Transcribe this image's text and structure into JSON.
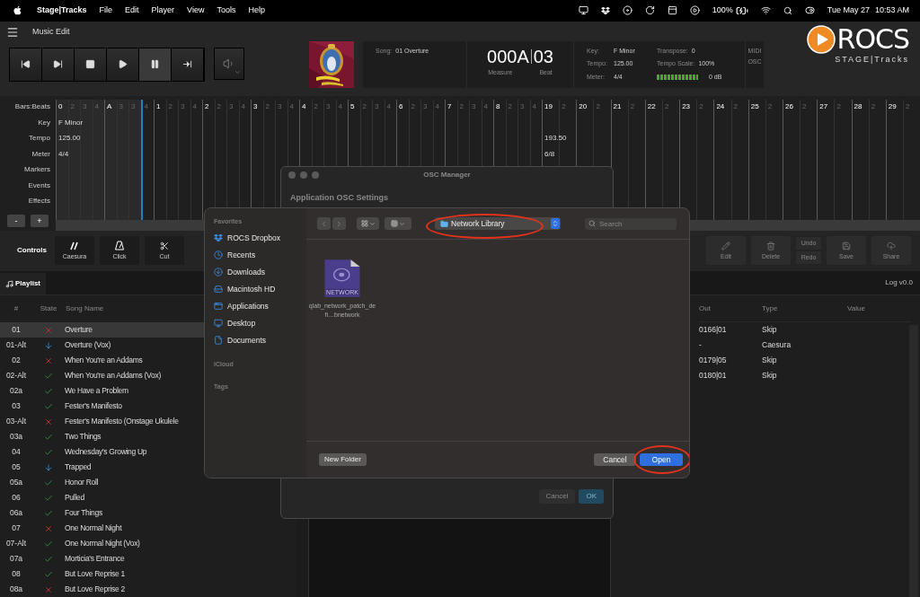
{
  "menu_bar": {
    "app": "Stage|Tracks",
    "menus": [
      "File",
      "Edit",
      "Player",
      "View",
      "Tools",
      "Help"
    ],
    "battery": "100%",
    "date": "Tue May 27",
    "time": "10:53 AM"
  },
  "header": {
    "title": "Music Edit",
    "transport": [
      {
        "kind": "prev",
        "selected": false
      },
      {
        "kind": "next",
        "selected": false
      },
      {
        "kind": "stop",
        "selected": false
      },
      {
        "kind": "play",
        "selected": false
      },
      {
        "kind": "pause",
        "selected": true
      },
      {
        "kind": "end",
        "selected": false
      }
    ],
    "song_label": "Song:",
    "song": "01 Overture",
    "measure": "000A",
    "beat": "03",
    "measure_label": "Measure",
    "beat_label": "Beat",
    "info_left": [
      {
        "label": "Key:",
        "value": "F Minor"
      },
      {
        "label": "Tempo:",
        "value": "125.00"
      },
      {
        "label": "Meter:",
        "value": "4/4"
      }
    ],
    "info_right": [
      {
        "label": "Transpose:",
        "value": "0"
      },
      {
        "label": "Tempo Scale:",
        "value": "100%"
      }
    ],
    "meter": {
      "level": 1,
      "reading": "0 dB"
    },
    "indicators": [
      "MIDI",
      "OSC"
    ],
    "logo": {
      "name": "ROCS",
      "tagline": "STAGE|Tracks"
    }
  },
  "timeline": {
    "tracks": [
      "Bars:Beats",
      "Key",
      "Tempo",
      "Meter",
      "Markers",
      "Events",
      "Effects"
    ],
    "zoom_buttons": [
      "-",
      "+"
    ],
    "sections": [
      {
        "key": "F Minor",
        "tempo": "125.00",
        "meter": "4/4",
        "cells": [
          {
            "beat": "0",
            "kind": "bar",
            "playhead": false
          },
          {
            "beat": "2",
            "kind": "beat",
            "playhead": false
          },
          {
            "beat": "3",
            "kind": "beat",
            "playhead": false
          },
          {
            "beat": "4",
            "kind": "beat",
            "playhead": false
          },
          {
            "beat": "A",
            "kind": "bar",
            "playhead": false
          },
          {
            "beat": "3",
            "kind": "beat",
            "playhead": false
          },
          {
            "beat": "3",
            "kind": "beat",
            "playhead": false
          },
          {
            "beat": "4",
            "kind": "beat",
            "playhead": true
          },
          {
            "beat": "1",
            "kind": "bar",
            "playhead": false
          },
          {
            "beat": "2",
            "kind": "beat",
            "playhead": false
          },
          {
            "beat": "3",
            "kind": "beat",
            "playhead": false
          },
          {
            "beat": "4",
            "kind": "beat",
            "playhead": false
          },
          {
            "beat": "2",
            "kind": "bar",
            "playhead": false
          },
          {
            "beat": "2",
            "kind": "beat",
            "playhead": false
          },
          {
            "beat": "3",
            "kind": "beat",
            "playhead": false
          },
          {
            "beat": "4",
            "kind": "beat",
            "playhead": false
          },
          {
            "beat": "3",
            "kind": "bar",
            "playhead": false
          },
          {
            "beat": "2",
            "kind": "beat",
            "playhead": false
          },
          {
            "beat": "3",
            "kind": "beat",
            "playhead": false
          },
          {
            "beat": "4",
            "kind": "beat",
            "playhead": false
          },
          {
            "beat": "4",
            "kind": "bar",
            "playhead": false
          },
          {
            "beat": "2",
            "kind": "beat",
            "playhead": false
          },
          {
            "beat": "3",
            "kind": "beat",
            "playhead": false
          },
          {
            "beat": "4",
            "kind": "beat",
            "playhead": false
          },
          {
            "beat": "5",
            "kind": "bar",
            "playhead": false
          },
          {
            "beat": "2",
            "kind": "beat",
            "playhead": false
          },
          {
            "beat": "3",
            "kind": "beat",
            "playhead": false
          },
          {
            "beat": "4",
            "kind": "beat",
            "playhead": false
          },
          {
            "beat": "6",
            "kind": "bar",
            "playhead": false
          },
          {
            "beat": "2",
            "kind": "beat",
            "playhead": false
          },
          {
            "beat": "3",
            "kind": "beat",
            "playhead": false
          },
          {
            "beat": "4",
            "kind": "beat",
            "playhead": false
          },
          {
            "beat": "7",
            "kind": "bar",
            "playhead": false
          },
          {
            "beat": "2",
            "kind": "beat",
            "playhead": false
          },
          {
            "beat": "3",
            "kind": "beat",
            "playhead": false
          },
          {
            "beat": "4",
            "kind": "beat",
            "playhead": false
          },
          {
            "beat": "8",
            "kind": "bar",
            "playhead": false
          },
          {
            "beat": "2",
            "kind": "beat",
            "playhead": false
          },
          {
            "beat": "3",
            "kind": "beat",
            "playhead": false
          },
          {
            "beat": "4",
            "kind": "beat",
            "playhead": false
          }
        ]
      },
      {
        "tempo": "193.50",
        "meter": "6/8",
        "cells": [
          {
            "beat": "19",
            "kind": "bar",
            "playhead": false
          },
          {
            "beat": "2",
            "kind": "beat",
            "playhead": false
          },
          {
            "beat": "20",
            "kind": "bar",
            "playhead": false
          },
          {
            "beat": "2",
            "kind": "beat",
            "playhead": false
          },
          {
            "beat": "21",
            "kind": "bar",
            "playhead": false
          },
          {
            "beat": "2",
            "kind": "beat",
            "playhead": false
          },
          {
            "beat": "22",
            "kind": "bar",
            "playhead": false
          },
          {
            "beat": "2",
            "kind": "beat",
            "playhead": false
          },
          {
            "beat": "23",
            "kind": "bar",
            "playhead": false
          },
          {
            "beat": "2",
            "kind": "beat",
            "playhead": false
          },
          {
            "beat": "24",
            "kind": "bar",
            "playhead": false
          },
          {
            "beat": "2",
            "kind": "beat",
            "playhead": false
          },
          {
            "beat": "25",
            "kind": "bar",
            "playhead": false
          },
          {
            "beat": "2",
            "kind": "beat",
            "playhead": false
          },
          {
            "beat": "26",
            "kind": "bar",
            "playhead": false
          },
          {
            "beat": "2",
            "kind": "beat",
            "playhead": false
          },
          {
            "beat": "27",
            "kind": "bar",
            "playhead": false
          },
          {
            "beat": "2",
            "kind": "beat",
            "playhead": false
          },
          {
            "beat": "28",
            "kind": "bar",
            "playhead": false
          },
          {
            "beat": "2",
            "kind": "beat",
            "playhead": false
          },
          {
            "beat": "29",
            "kind": "bar",
            "playhead": false
          },
          {
            "beat": "2",
            "kind": "beat",
            "playhead": false
          }
        ]
      }
    ]
  },
  "controls": {
    "label": "Controls",
    "left": [
      {
        "label": "Caesura",
        "kind": "caesura",
        "disabled": false
      },
      {
        "label": "Click",
        "kind": "click",
        "disabled": false
      },
      {
        "label": "Cut",
        "kind": "cut",
        "disabled": false
      }
    ],
    "edit": [
      {
        "label": "Edit",
        "kind": "edit",
        "disabled": true
      },
      {
        "label": "Delete",
        "kind": "delete",
        "disabled": true
      }
    ],
    "history": [
      "Undo",
      "Redo"
    ],
    "file": [
      {
        "label": "Save",
        "kind": "save",
        "disabled": true
      },
      {
        "label": "Share",
        "kind": "share",
        "disabled": true
      }
    ]
  },
  "playlist": {
    "tab": "Playlist",
    "columns": [
      "#",
      "State",
      "Song Name"
    ],
    "rows": [
      {
        "number": "01",
        "kind": "cross",
        "name": "Overture",
        "selected": true
      },
      {
        "number": "01-Alt",
        "kind": "down",
        "name": "Overture (Vox)",
        "selected": false
      },
      {
        "number": "02",
        "kind": "cross",
        "name": "When You're an Addams",
        "selected": false
      },
      {
        "number": "02-Alt",
        "kind": "check",
        "name": "When You're an Addams (Vox)",
        "selected": false
      },
      {
        "number": "02a",
        "kind": "check",
        "name": "We Have a Problem",
        "selected": false
      },
      {
        "number": "03",
        "kind": "check",
        "name": "Fester's Manifesto",
        "selected": false
      },
      {
        "number": "03-Alt",
        "kind": "cross",
        "name": "Fester's Manifesto (Onstage Ukulele",
        "selected": false
      },
      {
        "number": "03a",
        "kind": "check",
        "name": "Two Things",
        "selected": false
      },
      {
        "number": "04",
        "kind": "check",
        "name": "Wednesday's Growing Up",
        "selected": false
      },
      {
        "number": "05",
        "kind": "down",
        "name": "Trapped",
        "selected": false
      },
      {
        "number": "05a",
        "kind": "check",
        "name": "Honor Roll",
        "selected": false
      },
      {
        "number": "06",
        "kind": "check",
        "name": "Pulled",
        "selected": false
      },
      {
        "number": "06a",
        "kind": "check",
        "name": "Four Things",
        "selected": false
      },
      {
        "number": "07",
        "kind": "cross",
        "name": "One Normal Night",
        "selected": false
      },
      {
        "number": "07-Alt",
        "kind": "check",
        "name": "One Normal Night (Vox)",
        "selected": false
      },
      {
        "number": "07a",
        "kind": "check",
        "name": "Morticia's Entrance",
        "selected": false
      },
      {
        "number": "08",
        "kind": "check",
        "name": "But Love Reprise 1",
        "selected": false
      },
      {
        "number": "08a",
        "kind": "cross",
        "name": "But Love Reprise 2",
        "selected": false
      }
    ]
  },
  "log": {
    "title": "Log v0.0",
    "columns": [
      "Out",
      "Type",
      "Value"
    ],
    "rows": [
      {
        "out": "0166|01",
        "type": "Skip"
      },
      {
        "out": "-",
        "type": "Caesura"
      },
      {
        "out": "0179|05",
        "type": "Skip"
      },
      {
        "out": "0180|01",
        "type": "Skip"
      }
    ]
  },
  "osc_window": {
    "title": "OSC Manager",
    "heading": "Application OSC Settings",
    "buttons": [
      "Cancel",
      "OK"
    ]
  },
  "open_dialog": {
    "sidebar": [
      {
        "title": "Favorites",
        "items": [
          {
            "label": "ROCS Dropbox",
            "kind": "dropbox"
          },
          {
            "label": "Recents",
            "kind": "recents"
          },
          {
            "label": "Downloads",
            "kind": "downloads"
          },
          {
            "label": "Macintosh HD",
            "kind": "disk"
          },
          {
            "label": "Applications",
            "kind": "applications"
          },
          {
            "label": "Desktop",
            "kind": "desktop"
          },
          {
            "label": "Documents",
            "kind": "documents"
          }
        ]
      },
      {
        "title": "iCloud"
      },
      {
        "title": "Tags"
      }
    ],
    "location": {
      "label": "Network Library",
      "highlighted": true
    },
    "search": {
      "placeholder": "Search"
    },
    "files": [
      {
        "name": "qlab_network_patch_defi…bnetwork",
        "badge": "NETWORK"
      }
    ],
    "new_folder": "New Folder",
    "buttons": [
      {
        "label": "Cancel",
        "kind": "secondary",
        "highlighted": false
      },
      {
        "label": "Open",
        "kind": "primary",
        "highlighted": true
      }
    ]
  }
}
